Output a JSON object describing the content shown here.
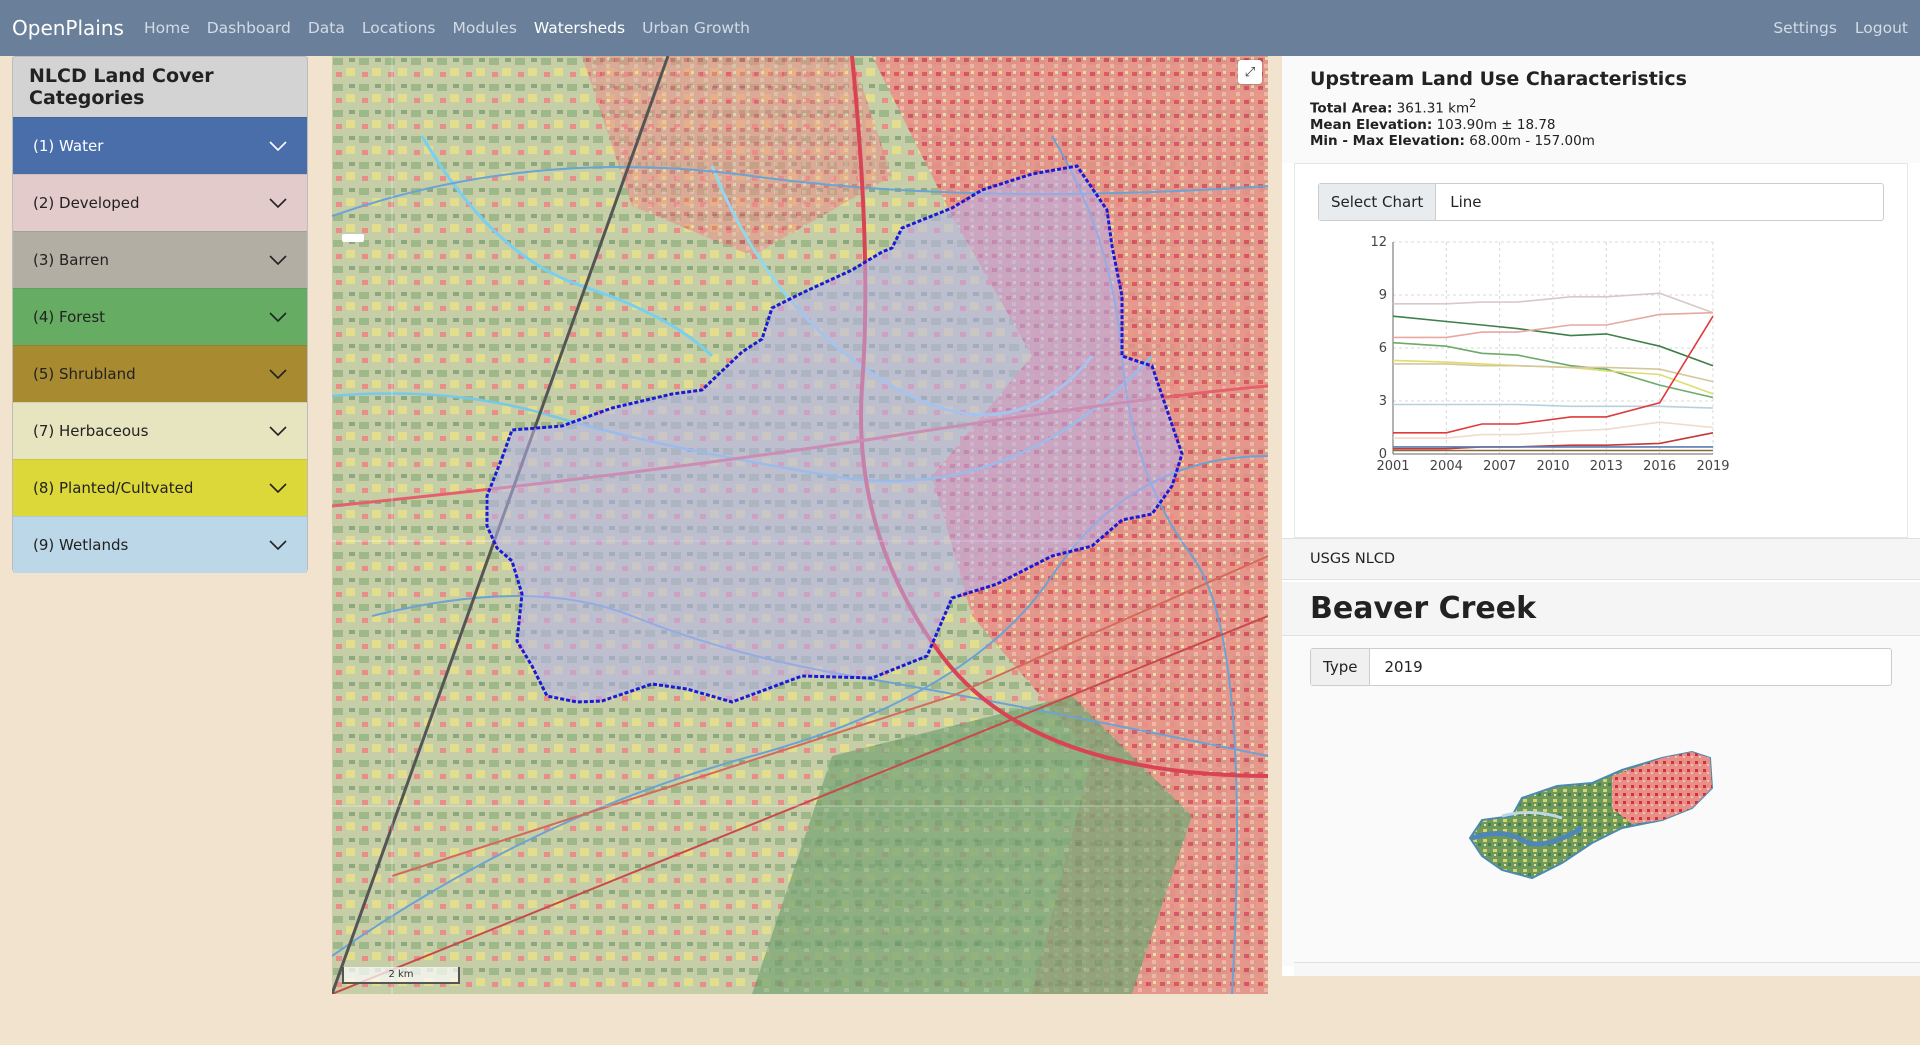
{
  "navbar": {
    "brand": "OpenPlains",
    "links": [
      "Home",
      "Dashboard",
      "Data",
      "Locations",
      "Modules",
      "Watersheds",
      "Urban Growth"
    ],
    "active": "Watersheds",
    "right_links": [
      "Settings",
      "Logout"
    ]
  },
  "left_panel": {
    "title": "NLCD Land Cover Categories",
    "categories": [
      {
        "label": "(1) Water",
        "color": "#4a6ea9",
        "text_color": "#ffffff"
      },
      {
        "label": "(2) Developed",
        "color": "#e3cbcb",
        "text_color": "#222222"
      },
      {
        "label": "(3) Barren",
        "color": "#b3aea3",
        "text_color": "#222222"
      },
      {
        "label": "(4) Forest",
        "color": "#66ad63",
        "text_color": "#222222"
      },
      {
        "label": "(5) Shrubland",
        "color": "#a88a30",
        "text_color": "#222222"
      },
      {
        "label": "(7) Herbaceous",
        "color": "#e7e4c0",
        "text_color": "#222222"
      },
      {
        "label": "(8) Planted/Cultvated",
        "color": "#dcd83a",
        "text_color": "#222222"
      },
      {
        "label": "(9) Wetlands",
        "color": "#bcd8e8",
        "text_color": "#222222"
      }
    ]
  },
  "map": {
    "expand_icon": "expand-icon",
    "scale_label": "2 km",
    "watershed_outline_color": "#1a1ad6"
  },
  "stats": {
    "title": "Upstream Land Use Characteristics",
    "total_area_label": "Total Area:",
    "total_area_value": "361.31 km",
    "total_area_unit_sup": "2",
    "mean_elev_label": "Mean Elevation:",
    "mean_elev_value": "103.90m ± 18.78",
    "minmax_label": "Min - Max Elevation:",
    "minmax_value": "68.00m - 157.00m"
  },
  "chart_select": {
    "label": "Select Chart",
    "value": "Line"
  },
  "chart_data": {
    "type": "line",
    "x": [
      2001,
      2004,
      2006,
      2008,
      2011,
      2013,
      2016,
      2019
    ],
    "x_ticks": [
      "2001",
      "2004",
      "2007",
      "2010",
      "2013",
      "2016",
      "2019"
    ],
    "y_ticks": [
      "0",
      "3",
      "6",
      "9",
      "12"
    ],
    "ylim": [
      0,
      12
    ],
    "xlim": [
      2001,
      2019
    ],
    "grid": true,
    "series": [
      {
        "color": "#d9c8c8",
        "values": [
          8.5,
          8.5,
          8.6,
          8.6,
          8.9,
          8.9,
          9.1,
          8.0
        ]
      },
      {
        "color": "#3f7f4a",
        "values": [
          7.8,
          7.5,
          7.3,
          7.1,
          6.7,
          6.8,
          6.1,
          5.0
        ]
      },
      {
        "color": "#e7a8a0",
        "values": [
          6.6,
          6.6,
          6.9,
          6.9,
          7.3,
          7.3,
          7.9,
          8.0
        ]
      },
      {
        "color": "#6dab6b",
        "values": [
          6.3,
          6.1,
          5.7,
          5.6,
          5.0,
          4.8,
          3.9,
          3.2
        ]
      },
      {
        "color": "#e0dc70",
        "values": [
          5.3,
          5.2,
          5.1,
          5.0,
          4.9,
          4.7,
          4.5,
          3.4
        ]
      },
      {
        "color": "#d4c79a",
        "values": [
          5.1,
          5.1,
          5.0,
          5.0,
          4.9,
          4.9,
          4.8,
          4.1
        ]
      },
      {
        "color": "#b8d0de",
        "values": [
          2.8,
          2.8,
          2.8,
          2.8,
          2.7,
          2.7,
          2.7,
          2.6
        ]
      },
      {
        "color": "#e03a3a",
        "values": [
          1.2,
          1.2,
          1.7,
          1.7,
          2.1,
          2.1,
          2.9,
          7.8
        ]
      },
      {
        "color": "#efdbcc",
        "values": [
          0.9,
          0.9,
          1.1,
          1.1,
          1.3,
          1.4,
          1.8,
          1.5
        ]
      },
      {
        "color": "#c23a3a",
        "values": [
          0.3,
          0.3,
          0.4,
          0.4,
          0.5,
          0.5,
          0.6,
          1.2
        ]
      },
      {
        "color": "#5a7bb0",
        "values": [
          0.4,
          0.4,
          0.4,
          0.4,
          0.4,
          0.4,
          0.4,
          0.4
        ]
      },
      {
        "color": "#8b6a3a",
        "values": [
          0.2,
          0.2,
          0.2,
          0.2,
          0.2,
          0.2,
          0.2,
          0.2
        ]
      }
    ]
  },
  "dataset_section": "USGS NLCD",
  "watershed": {
    "name": "Beaver Creek",
    "type_label": "Type",
    "type_value": "2019"
  }
}
